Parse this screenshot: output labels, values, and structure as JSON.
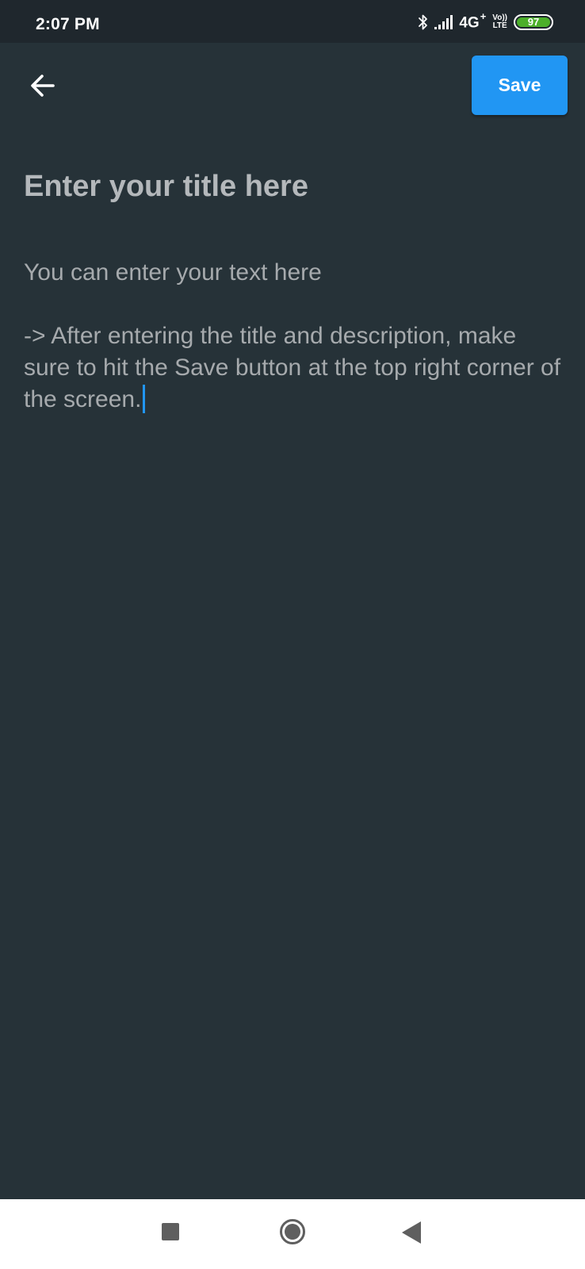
{
  "status_bar": {
    "time": "2:07 PM",
    "network": "4G",
    "network_plus": "+",
    "volte_top": "Vo))",
    "volte_bottom": "LTE",
    "battery_level": "97",
    "icons": [
      "bluetooth-icon",
      "signal-icon",
      "battery-icon"
    ]
  },
  "toolbar": {
    "back_icon": "arrow-left-icon",
    "save_label": "Save",
    "save_color": "#2196f3"
  },
  "editor": {
    "title_placeholder": "Enter your title here",
    "body_line_1": "You can enter your text here",
    "body_line_2": "-> After entering the title and description, make sure to hit the Save button at the top right corner of the screen.",
    "background_color": "#263238",
    "cursor_color": "#2196f3"
  },
  "nav_bar": {
    "recent_icon": "square-recent-icon",
    "home_icon": "circle-home-icon",
    "back_icon": "triangle-back-icon"
  }
}
